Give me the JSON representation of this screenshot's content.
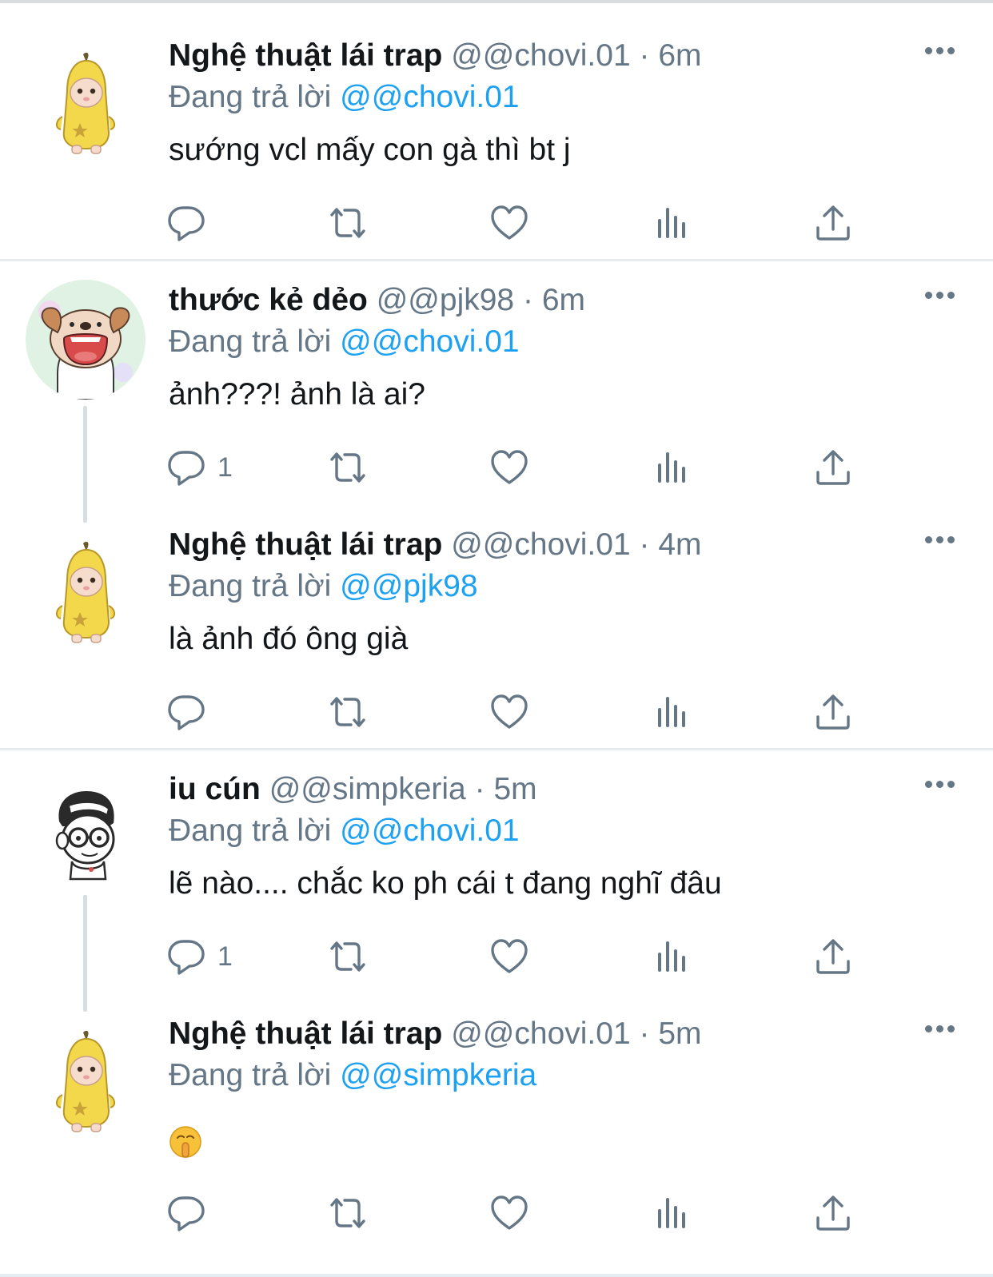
{
  "tweets": [
    {
      "display_name": "Nghệ thuật lái trap",
      "handle": "@@chovi.01",
      "sep": "·",
      "time": "6m",
      "reply_prefix": "Đang trả lời",
      "reply_to": "@@chovi.01",
      "text": "sướng vcl mấy con gà thì bt j",
      "avatar_icon": "banana-costume-avatar",
      "reply_count": ""
    },
    {
      "display_name": "thước kẻ dẻo",
      "handle": "@@pjk98",
      "sep": "·",
      "time": "6m",
      "reply_prefix": "Đang trả lời",
      "reply_to": "@@chovi.01",
      "text": "ảnh???! ảnh là ai?",
      "avatar_icon": "screaming-dog-avatar",
      "reply_count": "1"
    },
    {
      "display_name": "Nghệ thuật lái trap",
      "handle": "@@chovi.01",
      "sep": "·",
      "time": "4m",
      "reply_prefix": "Đang trả lời",
      "reply_to": "@@pjk98",
      "text": "là ảnh đó ông già",
      "avatar_icon": "banana-costume-avatar",
      "reply_count": ""
    },
    {
      "display_name": "iu cún",
      "handle": "@@simpkeria",
      "sep": "·",
      "time": "5m",
      "reply_prefix": "Đang trả lời",
      "reply_to": "@@chovi.01",
      "text": "lẽ nào.... chắc ko ph cái t đang nghĩ đâu",
      "avatar_icon": "cartoon-boy-glasses-avatar",
      "reply_count": "1"
    },
    {
      "display_name": "Nghệ thuật lái trap",
      "handle": "@@chovi.01",
      "sep": "·",
      "time": "5m",
      "reply_prefix": "Đang trả lời",
      "reply_to": "@@simpkeria",
      "text": "",
      "emoji_icon": "shushing-face-emoji",
      "avatar_icon": "banana-costume-avatar",
      "reply_count": ""
    }
  ],
  "icons": {
    "reply": "reply-bubble-icon",
    "retweet": "retweet-icon",
    "like": "heart-icon",
    "analytics": "analytics-bars-icon",
    "share": "share-icon",
    "more": "more-dots-icon"
  },
  "colors": {
    "link": "#1da1f2",
    "meta": "#657786",
    "text": "#14171a",
    "icon": "#657786",
    "divider": "#e6ecf0"
  }
}
